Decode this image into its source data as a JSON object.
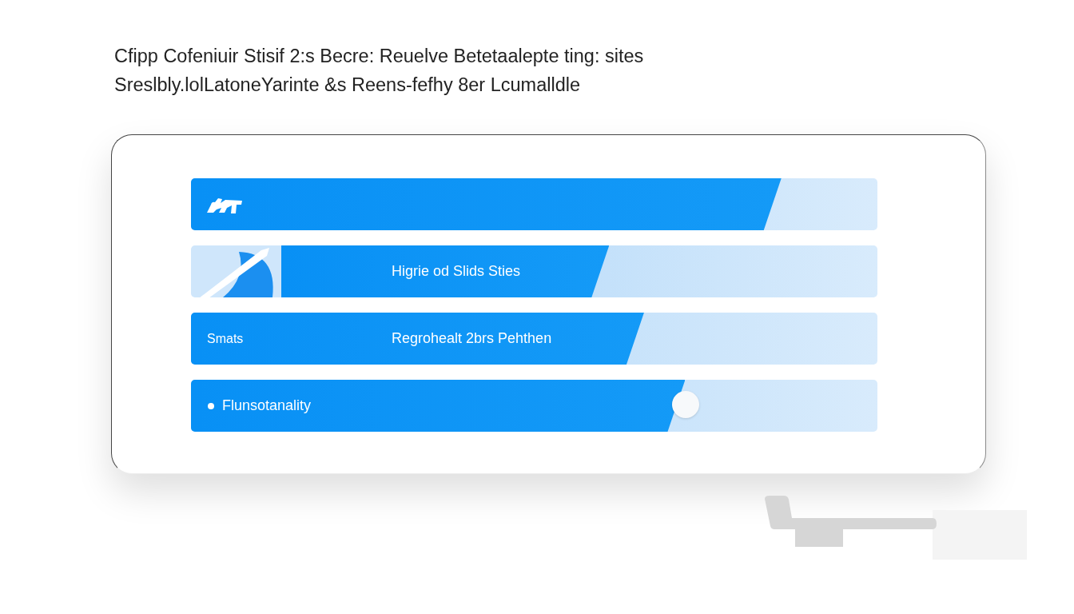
{
  "heading": {
    "lines": [
      "Cfipp Cofeniuir Stisif 2:s Becre: Reuelve Betetaalepte ting: sites",
      "Sreslbly.lolLatoneYarinte &s Reens-fefhy 8er Lcumalldle"
    ]
  },
  "bars": [
    {
      "kind": "logo",
      "level": 0.86
    },
    {
      "kind": "pen",
      "label": "Higrie od Slids Sties",
      "level": 0.55
    },
    {
      "kind": "side_label",
      "side_label": "Smats",
      "label": "Regrohealt 2brs Pehthen",
      "level": 0.66
    },
    {
      "kind": "slider",
      "label": "Flunsotanality",
      "level": 0.72
    }
  ]
}
